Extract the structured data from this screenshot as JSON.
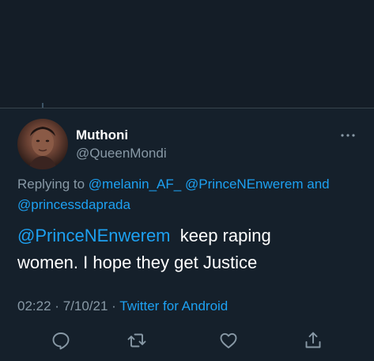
{
  "tweet": {
    "display_name": "Muthoni",
    "handle": "@QueenMondi",
    "replying_prefix": "Replying to",
    "replying_mentions": [
      "@melanin_AF_",
      "@PrinceNEnwerem"
    ],
    "replying_and": "and",
    "replying_last": "@princessdaprada",
    "body_mention": "@PrinceNEnwerem",
    "body_line1_rest": "keep raping",
    "body_line2": "women. I hope they get Justice",
    "time": "02:22",
    "separator": "·",
    "date": "7/10/21",
    "source": "Twitter for Android"
  },
  "icons": {
    "more": "more-horizontal-icon",
    "reply": "reply-icon",
    "retweet": "retweet-icon",
    "like": "heart-icon",
    "share": "share-icon"
  },
  "colors": {
    "background": "#15202b",
    "accent": "#1da1f2",
    "secondary_text": "#8899a6",
    "divider": "#38444d"
  }
}
